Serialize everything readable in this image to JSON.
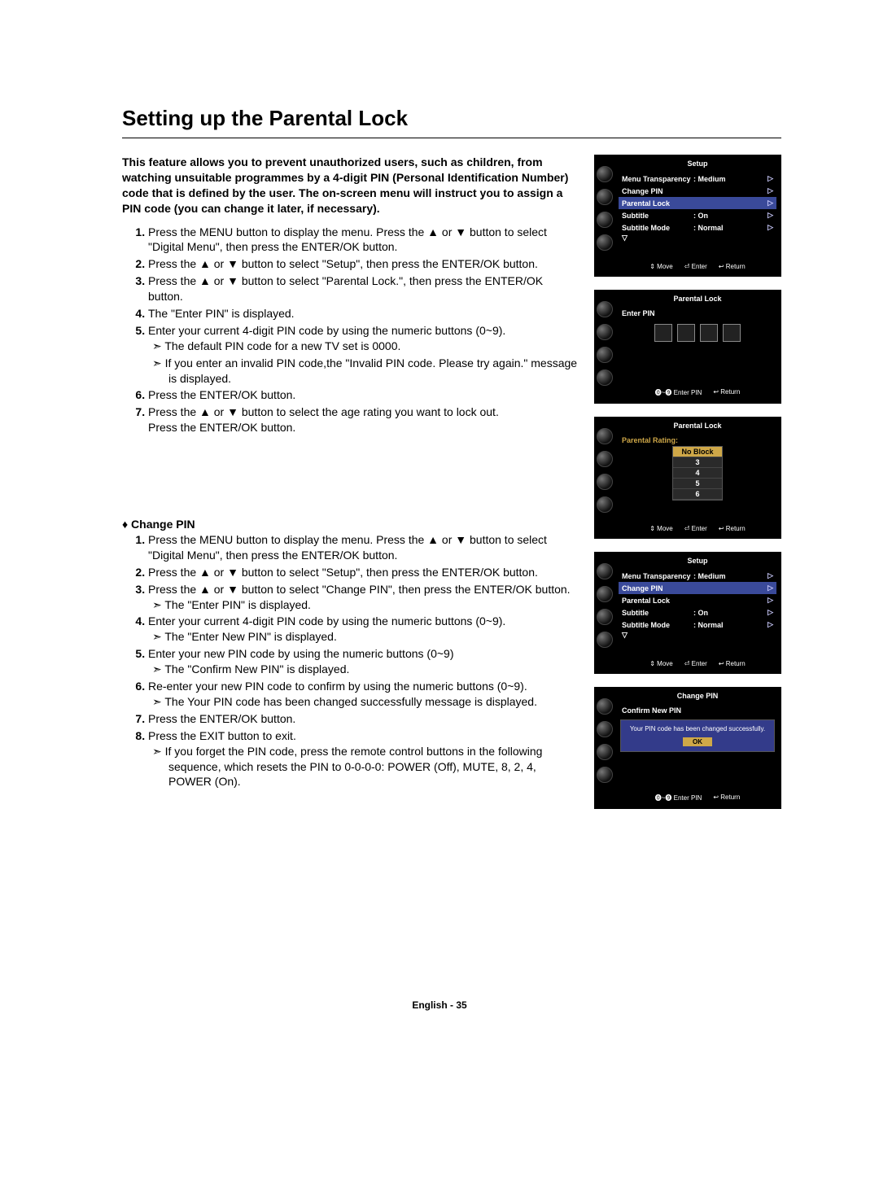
{
  "title": "Setting up the Parental Lock",
  "intro": "This feature allows you to prevent unauthorized users, such as children, from watching unsuitable programmes by a 4-digit PIN (Personal Identification Number) code that is defined by the user.  The on-screen menu will instruct you to assign a PIN code (you can change it later, if necessary).",
  "steps1": {
    "s1": "Press the MENU button to display the menu. Press the ▲ or ▼ button to select \"Digital Menu\", then press the ENTER/OK button.",
    "s2": "Press the ▲ or ▼ button to select \"Setup\", then press the ENTER/OK button.",
    "s3": "Press the ▲ or ▼ button to select \"Parental Lock.\", then press the ENTER/OK button.",
    "s4": "The \"Enter PIN\" is displayed.",
    "s5": "Enter your current 4-digit PIN code by using the numeric buttons (0~9).",
    "n5a": "The default PIN code for a new TV set is 0000.",
    "n5b": "If you enter an invalid PIN code,the \"Invalid PIN code. Please try again.\" message is displayed.",
    "s6": "Press the ENTER/OK button.",
    "s7": "Press the ▲ or ▼ button to select the age rating you want to lock out.\nPress the ENTER/OK button."
  },
  "subhead2": "Change PIN",
  "steps2": {
    "s1": "Press the MENU button to display the menu. Press the ▲ or ▼ button to select \"Digital Menu\", then press the ENTER/OK button.",
    "s2": "Press the ▲ or ▼ button to select \"Setup\", then press the ENTER/OK button.",
    "s3": "Press the ▲ or ▼ button to select \"Change PIN\", then press the ENTER/OK button.",
    "n3": "The \"Enter PIN\" is displayed.",
    "s4": "Enter your current 4-digit PIN code by using the numeric buttons (0~9).",
    "n4": "The \"Enter New PIN\" is displayed.",
    "s5": "Enter your new PIN code by using the numeric buttons (0~9)",
    "n5": "The \"Confirm New PIN\" is displayed.",
    "s6": "Re-enter your new PIN code to confirm by using the numeric buttons (0~9).",
    "n6": "The Your PIN code has been changed successfully message is displayed.",
    "s7": "Press the ENTER/OK button.",
    "s8": "Press the EXIT button to exit.",
    "n8": "If you forget the PIN code, press the remote control buttons in the following sequence, which resets the PIN to 0-0-0-0: POWER (Off), MUTE, 8, 2, 4, POWER (On)."
  },
  "osd1": {
    "title": "Setup",
    "rows": {
      "r1k": "Menu Transparency",
      "r1v": ": Medium",
      "r2k": "Change PIN",
      "r3k": "Parental Lock",
      "r4k": "Subtitle",
      "r4v": ": On",
      "r5k": "Subtitle  Mode",
      "r5v": ": Normal"
    },
    "foot": {
      "move": "Move",
      "enter": "Enter",
      "return": "Return"
    }
  },
  "osd2": {
    "title": "Parental Lock",
    "enterpin": "Enter PIN",
    "foot": {
      "pin": "Enter PIN",
      "return": "Return"
    }
  },
  "osd3": {
    "title": "Parental Lock",
    "label": "Parental Rating:",
    "ratings": {
      "r0": "No Block",
      "r1": "3",
      "r2": "4",
      "r3": "5",
      "r4": "6"
    },
    "foot": {
      "move": "Move",
      "enter": "Enter",
      "return": "Return"
    }
  },
  "osd4": {
    "title": "Setup",
    "rows": {
      "r1k": "Menu Transparency",
      "r1v": ": Medium",
      "r2k": "Change PIN",
      "r3k": "Parental Lock",
      "r4k": "Subtitle",
      "r4v": ": On",
      "r5k": "Subtitle  Mode",
      "r5v": ": Normal"
    },
    "foot": {
      "move": "Move",
      "enter": "Enter",
      "return": "Return"
    }
  },
  "osd5": {
    "title": "Change PIN",
    "confirm": "Confirm New PIN",
    "msg": "Your PIN code has been changed successfully.",
    "ok": "OK",
    "foot": {
      "pin": "Enter PIN",
      "return": "Return"
    }
  },
  "footer": "English - 35"
}
